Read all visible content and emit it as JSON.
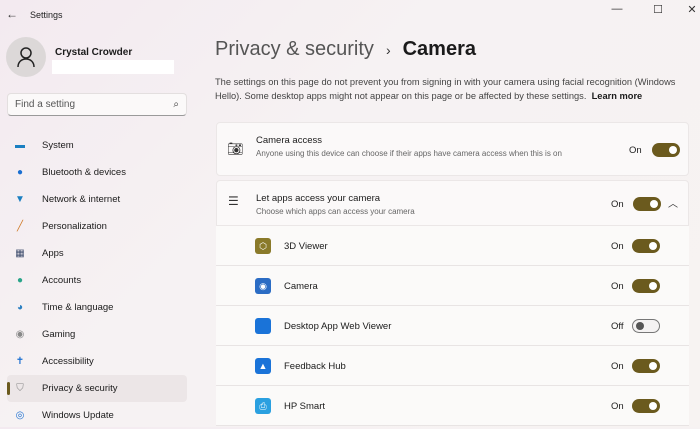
{
  "window": {
    "title": "Settings",
    "controls": [
      "minimize",
      "maximize",
      "close"
    ]
  },
  "user": {
    "name": "Crystal Crowder"
  },
  "search": {
    "placeholder": "Find a setting"
  },
  "nav": [
    {
      "label": "System",
      "icon": "display-icon",
      "color": "#1a7fc1"
    },
    {
      "label": "Bluetooth & devices",
      "icon": "bluetooth-icon",
      "color": "#1a6fd1"
    },
    {
      "label": "Network & internet",
      "icon": "wifi-icon",
      "color": "#1a7fc1"
    },
    {
      "label": "Personalization",
      "icon": "brush-icon",
      "color": "#d07a2a"
    },
    {
      "label": "Apps",
      "icon": "apps-icon",
      "color": "#3b4a6b"
    },
    {
      "label": "Accounts",
      "icon": "person-icon",
      "color": "#2aa58a"
    },
    {
      "label": "Time & language",
      "icon": "globe-clock-icon",
      "color": "#2a7fc1"
    },
    {
      "label": "Gaming",
      "icon": "gamepad-icon",
      "color": "#888"
    },
    {
      "label": "Accessibility",
      "icon": "accessibility-icon",
      "color": "#1a6fd1"
    },
    {
      "label": "Privacy & security",
      "icon": "shield-icon",
      "color": "#888",
      "selected": true
    },
    {
      "label": "Windows Update",
      "icon": "update-icon",
      "color": "#1a6fd1"
    }
  ],
  "breadcrumb": {
    "parent": "Privacy & security",
    "separator": "›",
    "current": "Camera"
  },
  "description": {
    "text": "The settings on this page do not prevent you from signing in with your camera using facial recognition (Windows Hello). Some desktop apps might not appear on this page or be affected by these settings.",
    "link": "Learn more"
  },
  "camera_access": {
    "title": "Camera access",
    "subtitle": "Anyone using this device can choose if their apps have camera access when this is on",
    "state": "On",
    "enabled": true
  },
  "let_apps": {
    "title": "Let apps access your camera",
    "subtitle": "Choose which apps can access your camera",
    "state": "On",
    "enabled": true,
    "expanded": true
  },
  "apps": [
    {
      "name": "3D Viewer",
      "state": "On",
      "enabled": true,
      "color": "#8a7a2a",
      "icon": "cube-icon"
    },
    {
      "name": "Camera",
      "state": "On",
      "enabled": true,
      "color": "#2b6cc4",
      "icon": "camera-app-icon"
    },
    {
      "name": "Desktop App Web Viewer",
      "state": "Off",
      "enabled": false,
      "color": "#1a73d8",
      "icon": "web-viewer-icon"
    },
    {
      "name": "Feedback Hub",
      "state": "On",
      "enabled": true,
      "color": "#1a73d8",
      "icon": "feedback-icon"
    },
    {
      "name": "HP Smart",
      "state": "On",
      "enabled": true,
      "color": "#2aa0e0",
      "icon": "printer-icon"
    }
  ],
  "colors": {
    "accent": "#6b5a1e"
  }
}
